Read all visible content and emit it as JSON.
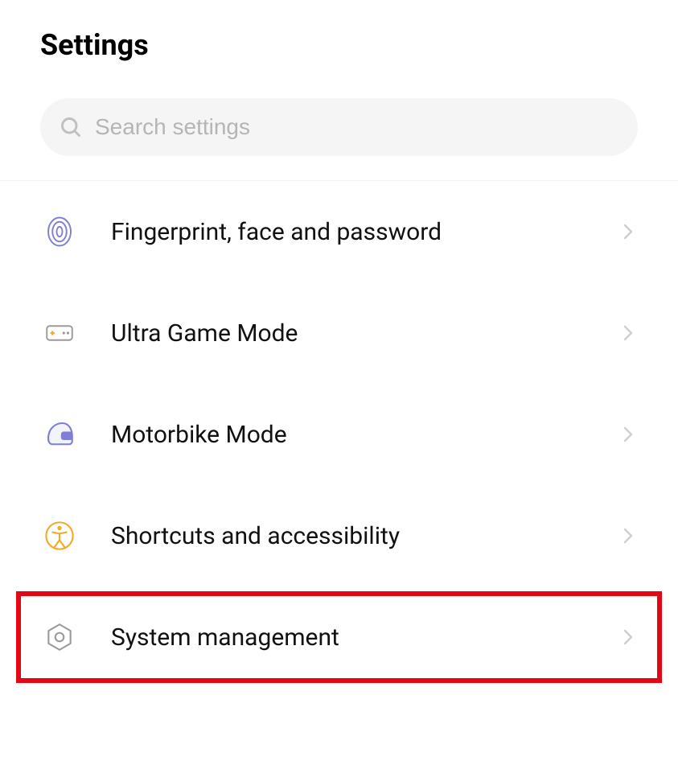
{
  "header": {
    "title": "Settings"
  },
  "search": {
    "placeholder": "Search settings"
  },
  "items": [
    {
      "label": "Fingerprint, face and password"
    },
    {
      "label": "Ultra Game Mode"
    },
    {
      "label": "Motorbike Mode"
    },
    {
      "label": "Shortcuts and accessibility"
    },
    {
      "label": "System management"
    }
  ],
  "highlight_index": 4,
  "colors": {
    "purple": "#7f7fd6",
    "orange": "#f4a929",
    "gray": "#9a9a9a",
    "red": "#e30613"
  }
}
